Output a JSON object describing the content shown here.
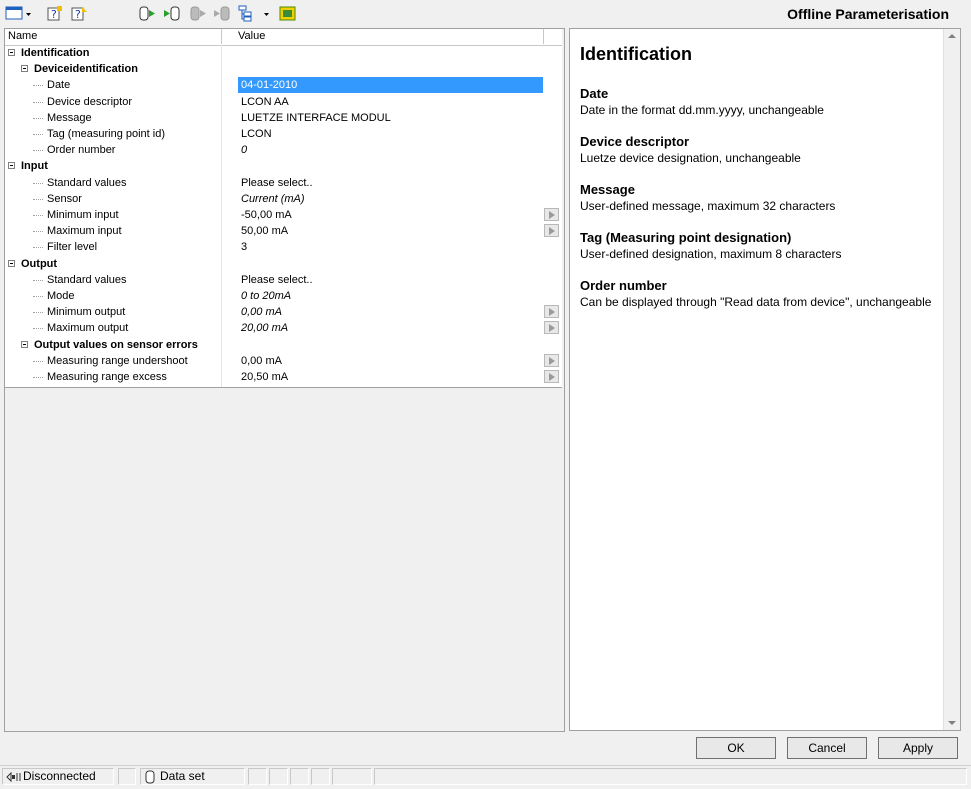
{
  "window": {
    "title": "Offline Parameterisation"
  },
  "toolbar": {
    "icons": [
      "window-menu-icon",
      "help-topic-icon",
      "help-context-icon",
      "upload-to-device-icon",
      "download-from-device-icon",
      "disabled-upload-icon",
      "disabled-download-icon",
      "tree-view-icon",
      "device-info-icon"
    ]
  },
  "grid": {
    "columns": [
      "Name",
      "Value"
    ],
    "rows": [
      {
        "name": "Identification",
        "value": "",
        "level": 0,
        "group": true
      },
      {
        "name": "Deviceidentification",
        "value": "",
        "level": 1,
        "group": true
      },
      {
        "name": "Date",
        "value": "04-01-2010",
        "level": 2,
        "selected": true
      },
      {
        "name": "Device descriptor",
        "value": "LCON AA",
        "level": 2
      },
      {
        "name": "Message",
        "value": "LUETZE INTERFACE MODUL",
        "level": 2
      },
      {
        "name": "Tag (measuring point id)",
        "value": "LCON",
        "level": 2
      },
      {
        "name": "Order number",
        "value": "0",
        "level": 2,
        "italic": true
      },
      {
        "name": "Input",
        "value": "",
        "level": 0,
        "group": true
      },
      {
        "name": "Standard values",
        "value": "Please select..",
        "level": 2
      },
      {
        "name": "Sensor",
        "value": "Current (mA)",
        "level": 2,
        "italic": true
      },
      {
        "name": "Minimum input",
        "value": "-50,00 mA",
        "level": 2,
        "spin": true
      },
      {
        "name": "Maximum input",
        "value": "50,00 mA",
        "level": 2,
        "spin": true
      },
      {
        "name": "Filter level",
        "value": "3",
        "level": 2
      },
      {
        "name": "Output",
        "value": "",
        "level": 0,
        "group": true
      },
      {
        "name": "Standard values",
        "value": "Please select..",
        "level": 2
      },
      {
        "name": "Mode",
        "value": "0 to 20mA",
        "level": 2,
        "italic": true
      },
      {
        "name": "Minimum output",
        "value": "0,00 mA",
        "level": 2,
        "italic": true,
        "spin": true
      },
      {
        "name": "Maximum output",
        "value": "20,00 mA",
        "level": 2,
        "italic": true,
        "spin": true
      },
      {
        "name": "Output values on sensor errors",
        "value": "",
        "level": 1,
        "group": true
      },
      {
        "name": "Measuring range undershoot",
        "value": "0,00 mA",
        "level": 2,
        "spin": true
      },
      {
        "name": "Measuring range excess",
        "value": "20,50 mA",
        "level": 2,
        "spin": true
      }
    ]
  },
  "help": {
    "title": "Identification",
    "sections": [
      {
        "title": "Date",
        "text": "Date in the format dd.mm.yyyy, unchangeable"
      },
      {
        "title": "Device descriptor",
        "text": "Luetze device designation, unchangeable"
      },
      {
        "title": "Message",
        "text": "User-defined message, maximum 32 characters"
      },
      {
        "title": "Tag (Measuring point designation)",
        "text": "User-defined designation, maximum 8 characters"
      },
      {
        "title": "Order number",
        "text": "Can be displayed through \"Read data from device\", unchangeable"
      }
    ]
  },
  "buttons": {
    "ok": "OK",
    "cancel": "Cancel",
    "apply": "Apply"
  },
  "status": {
    "connection": "Disconnected",
    "dataset": "Data set"
  }
}
